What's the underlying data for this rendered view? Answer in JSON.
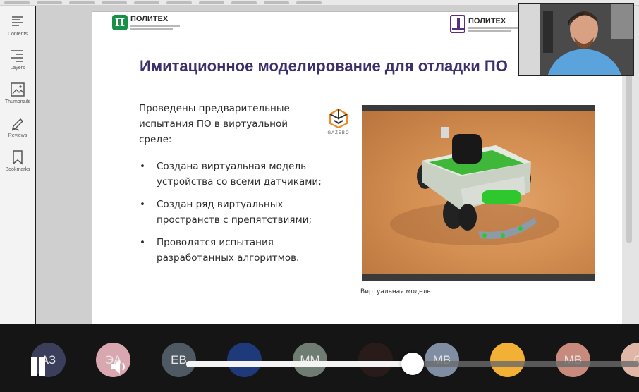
{
  "slide": {
    "logo_left_name": "ПОЛИТЕХ",
    "logo_right_name": "ПОЛИТЕХ",
    "title": "Имитационное моделирование для отладки ПО",
    "intro": "Проведены предварительные испытания ПО в виртуальной среде:",
    "bullets": [
      "Создана виртуальная модель устройства со всеми датчиками;",
      "Создан ряд виртуальных пространств с препятствиями;",
      "Проводятся испытания разработанных алгоритмов."
    ],
    "gazebo_label": "GAZEBO",
    "image_caption": "Виртуальная модель"
  },
  "sidebar": {
    "items": [
      {
        "label": "Contents",
        "icon": "list-icon"
      },
      {
        "label": "Layers",
        "icon": "layers-icon"
      },
      {
        "label": "Thumbnails",
        "icon": "thumbnails-icon"
      },
      {
        "label": "Reviews",
        "icon": "pen-icon"
      },
      {
        "label": "Bookmarks",
        "icon": "bookmark-icon"
      }
    ]
  },
  "participants": [
    {
      "initials": "АЗ",
      "color": "#3b3f5c"
    },
    {
      "initials": "ЭА",
      "color": "#d9a7b0"
    },
    {
      "initials": "EB",
      "color": "#4e5963"
    },
    {
      "initials": "",
      "color": "#1f3a7a"
    },
    {
      "initials": "MM",
      "color": "#6f7c72"
    },
    {
      "initials": "",
      "color": "#2a1b1b"
    },
    {
      "initials": "MB",
      "color": "#7f8ea3"
    },
    {
      "initials": "",
      "color": "#f2b134"
    },
    {
      "initials": "MB",
      "color": "#c98a7e"
    },
    {
      "initials": "С",
      "color": "#e0b7a6"
    }
  ],
  "playback": {
    "progress": 0.5
  }
}
